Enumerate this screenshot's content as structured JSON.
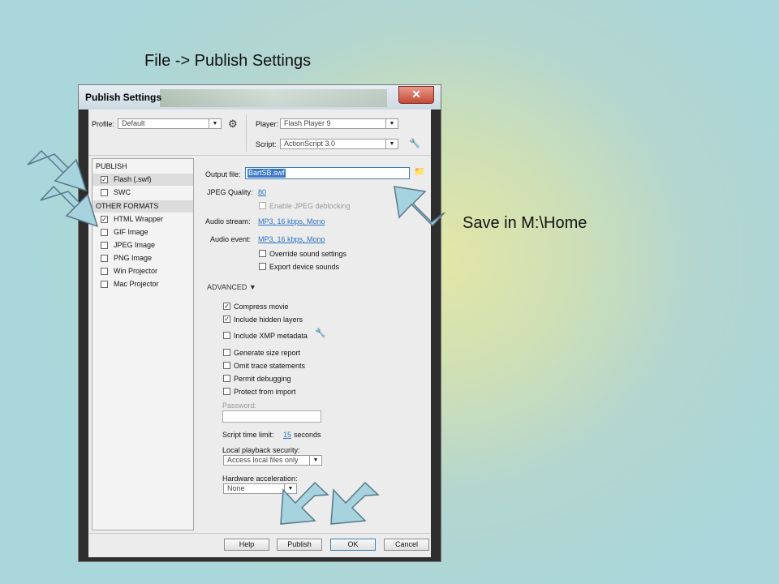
{
  "slide": {
    "title": "File -> Publish Settings",
    "note": "Save in M:\\Home"
  },
  "dialog": {
    "title": "Publish Settings",
    "close_glyph": "✕",
    "profile_label": "Profile:",
    "profile_value": "Default",
    "player_label": "Player:",
    "player_value": "Flash Player 9",
    "script_label": "Script:",
    "script_value": "ActionScript 3.0"
  },
  "formats": {
    "publish_header": "PUBLISH",
    "other_header": "OTHER FORMATS",
    "publish_items": [
      {
        "label": "Flash (.swf)",
        "checked": true
      },
      {
        "label": "SWC",
        "checked": false
      }
    ],
    "other_items": [
      {
        "label": "HTML Wrapper",
        "checked": true
      },
      {
        "label": "GIF Image",
        "checked": false
      },
      {
        "label": "JPEG Image",
        "checked": false
      },
      {
        "label": "PNG Image",
        "checked": false
      },
      {
        "label": "Win Projector",
        "checked": false
      },
      {
        "label": "Mac Projector",
        "checked": false
      }
    ]
  },
  "settings": {
    "output_file_label": "Output file:",
    "output_file_value": "BartSB.swf",
    "jpeg_quality_label": "JPEG Quality:",
    "jpeg_quality_value": "80",
    "enable_jpeg_deblocking": "Enable JPEG deblocking",
    "audio_stream_label": "Audio stream:",
    "audio_stream_value": "MP3, 16 kbps, Mono",
    "audio_event_label": "Audio event:",
    "audio_event_value": "MP3, 16 kbps, Mono",
    "override_sound": "Override sound settings",
    "export_device_sounds": "Export device sounds",
    "advanced_label": "ADVANCED ▼",
    "compress_movie": "Compress movie",
    "include_hidden_layers": "Include hidden layers",
    "include_xmp": "Include XMP metadata",
    "generate_size_report": "Generate size report",
    "omit_trace": "Omit trace statements",
    "permit_debugging": "Permit debugging",
    "protect_from_import": "Protect from import",
    "password_label": "Password:",
    "script_time_limit_label": "Script time limit:",
    "script_time_limit_value": "15",
    "seconds_label": "seconds",
    "local_playback_label": "Local playback security:",
    "local_playback_value": "Access local files only",
    "hardware_accel_label": "Hardware acceleration:",
    "hardware_accel_value": "None"
  },
  "buttons": {
    "help": "Help",
    "publish": "Publish",
    "ok": "OK",
    "cancel": "Cancel"
  },
  "colors": {
    "link": "#2a73c4",
    "arrow_fill": "#a7d3de",
    "arrow_stroke": "#58798a"
  }
}
